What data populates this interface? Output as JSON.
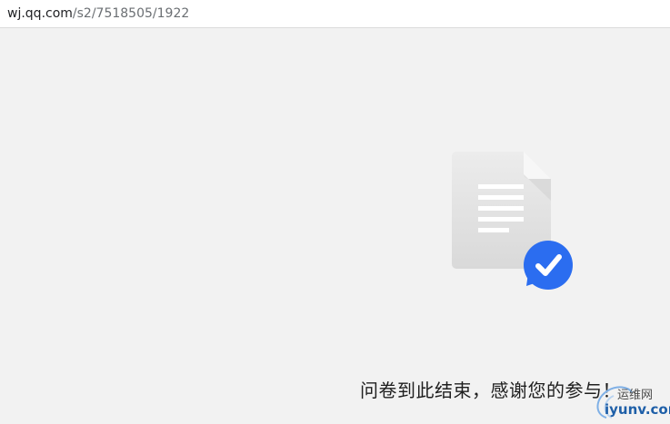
{
  "address_bar": {
    "host": "wj.qq.com",
    "path": "/s2/7518505/1922"
  },
  "main": {
    "end_message": "问卷到此结束，感谢您的参与！"
  },
  "watermark": {
    "cn": "运维网",
    "en": "iyunv.com"
  },
  "icons": {
    "document": "document-icon",
    "badge": "checkmark-badge-icon"
  },
  "colors": {
    "background": "#f2f2f2",
    "badge_blue": "#2b6df0",
    "doc_gray": "#dcdcdc"
  }
}
